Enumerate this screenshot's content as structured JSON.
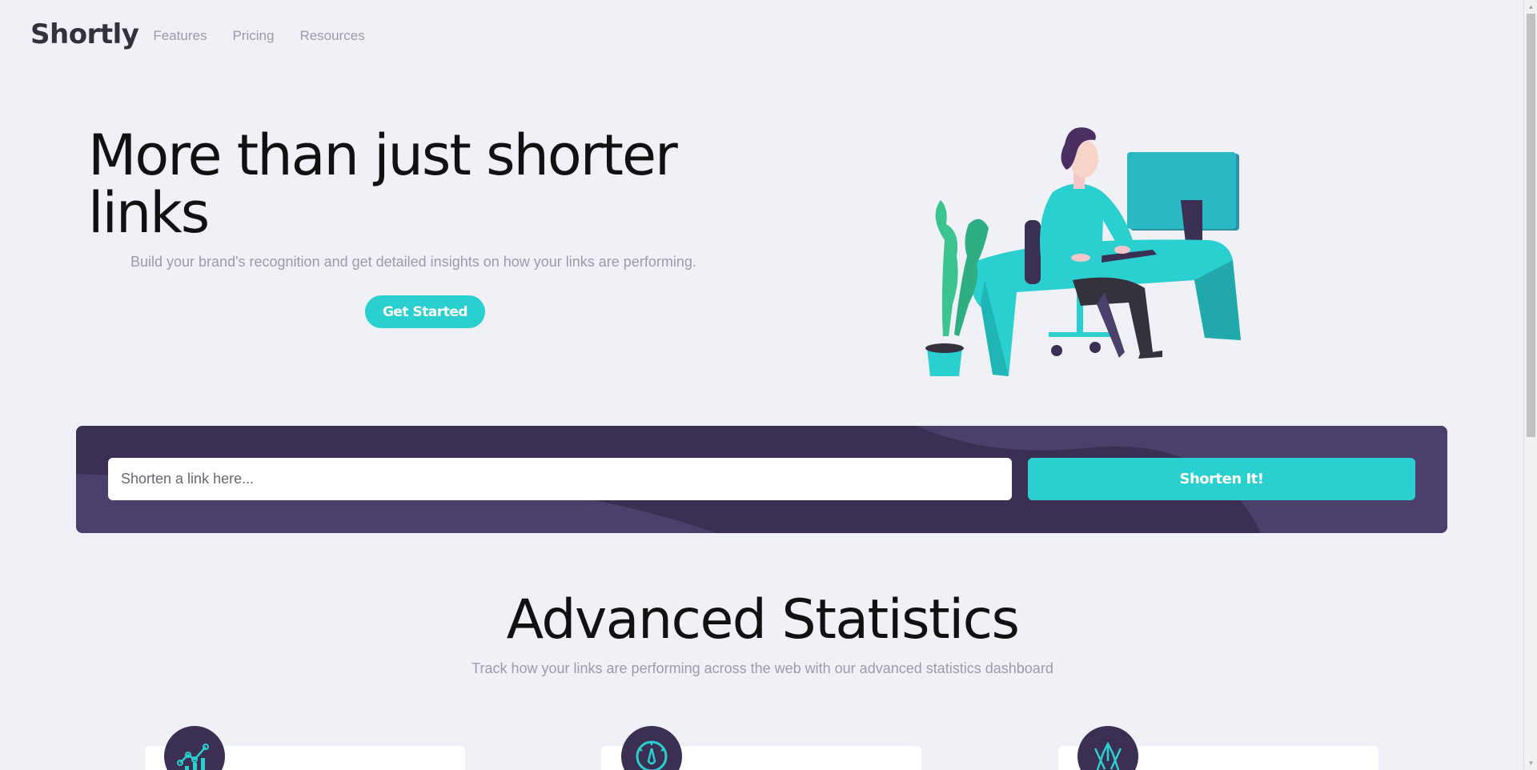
{
  "header": {
    "logo": "Shortly",
    "nav": [
      "Features",
      "Pricing",
      "Resources"
    ]
  },
  "hero": {
    "title": "More than just shorter links",
    "subtitle": "Build your brand's recognition and get detailed insights on how your links are performing.",
    "cta_label": "Get Started"
  },
  "shorten": {
    "placeholder": "Shorten a link here...",
    "button_label": "Shorten It!"
  },
  "statistics": {
    "title": "Advanced Statistics",
    "subtitle": "Track how your links are performing across the web with our advanced statistics dashboard",
    "cards": [
      {
        "icon": "brand-recognition-icon"
      },
      {
        "icon": "detailed-records-icon"
      },
      {
        "icon": "fully-customizable-icon"
      }
    ]
  },
  "colors": {
    "primary_cyan": "#2acfcf",
    "dark_violet": "#3b3054",
    "background": "#f0f1f6",
    "grayish_violet": "#9e9aa7"
  }
}
